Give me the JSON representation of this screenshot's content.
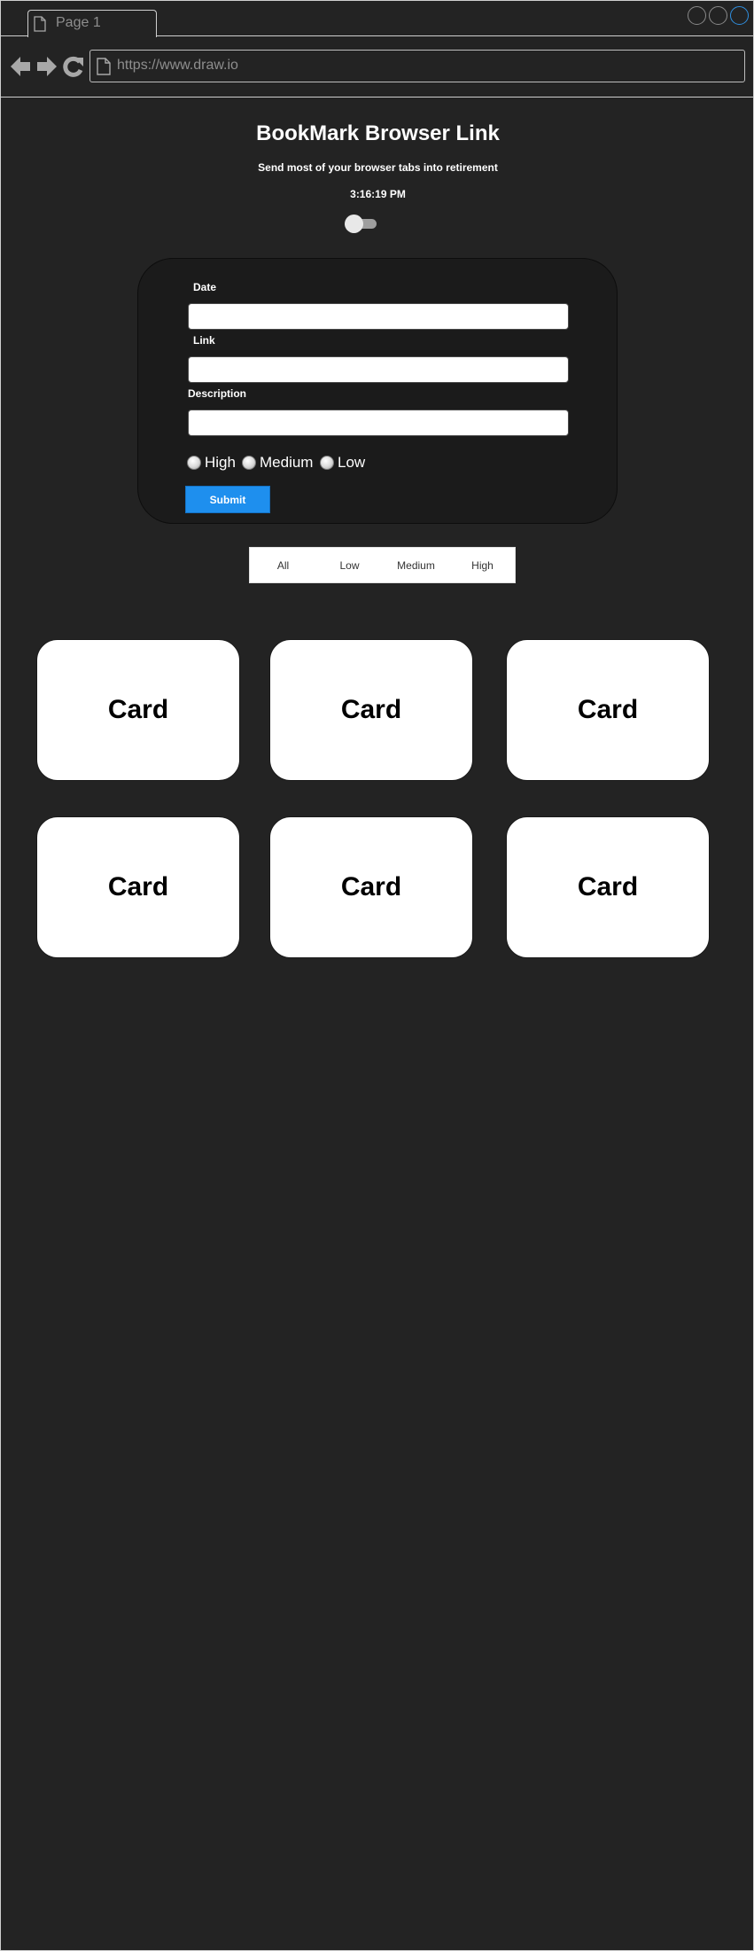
{
  "browser": {
    "tab_label": "Page 1",
    "address_placeholder": "https://www.draw.io",
    "icons": {
      "tab": "page-icon",
      "address": "page-icon",
      "back": "arrow-left-icon",
      "forward": "arrow-right-icon",
      "reload": "reload-icon",
      "window_buttons": [
        "circle-icon",
        "circle-icon",
        "circle-icon"
      ]
    },
    "colors": {
      "active_window_button": "#2f8fe0"
    }
  },
  "header": {
    "title": "BookMark Browser Link",
    "subtitle": "Send most of your browser tabs into retirement",
    "clock": "3:16:19 PM",
    "theme_toggle": "toggle-switch"
  },
  "form": {
    "date_label": "Date",
    "link_label": "Link",
    "description_label": "Description",
    "priorities": [
      "High",
      "Medium",
      "Low"
    ],
    "submit_label": "Submit",
    "colors": {
      "submit": "#1e8fee",
      "panel": "#1b1b1b"
    }
  },
  "filter": {
    "options": [
      "All",
      "Low",
      "Medium",
      "High"
    ]
  },
  "cards": [
    {
      "label": "Card"
    },
    {
      "label": "Card"
    },
    {
      "label": "Card"
    },
    {
      "label": "Card"
    },
    {
      "label": "Card"
    },
    {
      "label": "Card"
    }
  ],
  "colors": {
    "background": "#232323",
    "frame_border": "#cfcfcf"
  }
}
